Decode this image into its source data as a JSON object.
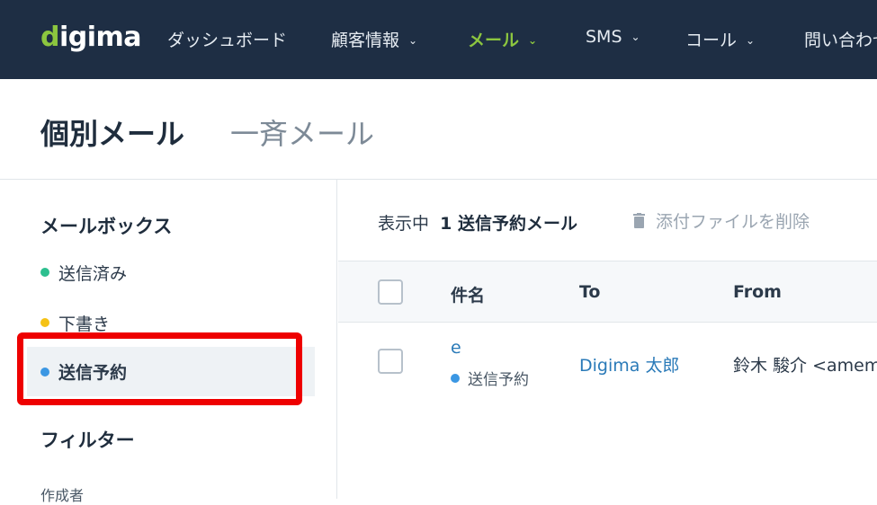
{
  "brand": {
    "logo": "digima"
  },
  "nav": {
    "items": [
      {
        "label": "ダッシュボード"
      },
      {
        "label": "顧客情報"
      },
      {
        "label": "メール"
      },
      {
        "label": "SMS"
      },
      {
        "label": "コール"
      },
      {
        "label": "問い合わせ"
      }
    ],
    "active": "メール",
    "accent_color": "#8cc63f"
  },
  "page": {
    "tabs": [
      {
        "label": "個別メール"
      },
      {
        "label": "一斉メール"
      }
    ]
  },
  "sidebar": {
    "mailbox_heading": "メールボックス",
    "items": [
      {
        "label": "送信済み",
        "dot_color": "#2dbf8f"
      },
      {
        "label": "下書き",
        "dot_color": "#f5c215"
      },
      {
        "label": "送信予約",
        "dot_color": "#3b97e3"
      }
    ],
    "selected": "送信予約",
    "filter_heading": "フィルター",
    "filter_author": "作成者"
  },
  "toolbar": {
    "showing_prefix": "表示中",
    "showing_count": "1 送信予約メール",
    "delete_attachments": "添付ファイルを削除"
  },
  "table": {
    "headers": [
      "件名",
      "To",
      "From"
    ],
    "rows": [
      {
        "subject": "e",
        "status": "送信予約",
        "to": "Digima 太郎",
        "from": "鈴木 駿介 <amem"
      }
    ]
  },
  "highlight_color": "#ee0000"
}
